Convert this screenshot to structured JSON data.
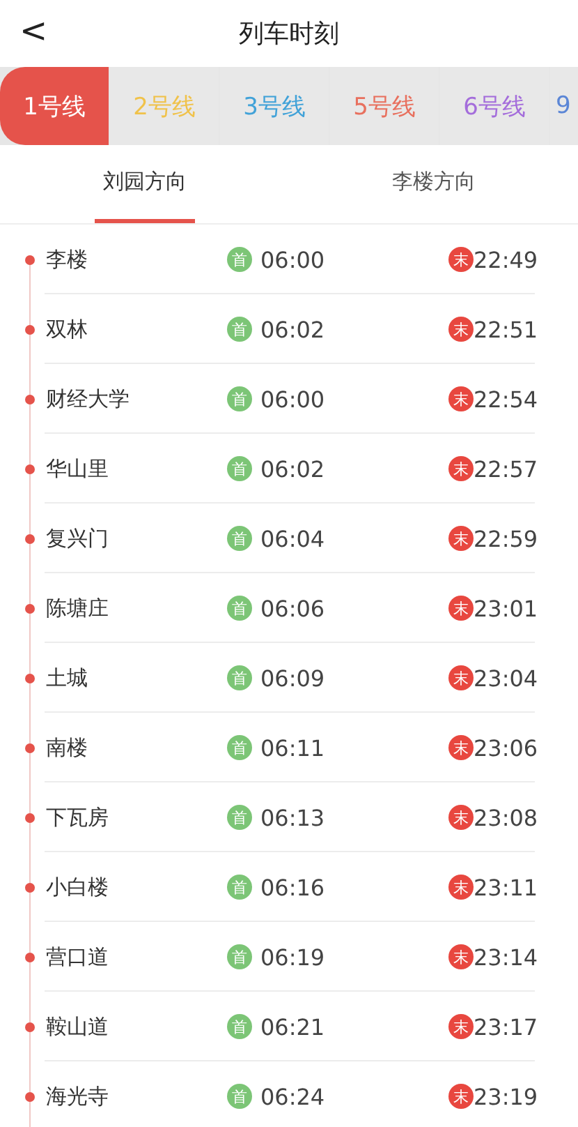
{
  "header": {
    "back": "<",
    "title": "列车时刻"
  },
  "lines": [
    {
      "label": "1号线",
      "color": "#e5534b",
      "selected": true
    },
    {
      "label": "2号线",
      "color": "#f0c24a",
      "selected": false
    },
    {
      "label": "3号线",
      "color": "#41a2d8",
      "selected": false
    },
    {
      "label": "5号线",
      "color": "#e8705e",
      "selected": false
    },
    {
      "label": "6号线",
      "color": "#a46ddb",
      "selected": false
    },
    {
      "label": "9",
      "color": "#5b86d6",
      "selected": false
    }
  ],
  "directions": [
    {
      "label": "刘园方向",
      "selected": true
    },
    {
      "label": "李楼方向",
      "selected": false
    }
  ],
  "stations": [
    {
      "name": "李楼",
      "first_badge": "首",
      "first": "06:00",
      "last_badge": "末",
      "last": "22:49"
    },
    {
      "name": "双林",
      "first_badge": "首",
      "first": "06:02",
      "last_badge": "末",
      "last": "22:51"
    },
    {
      "name": "财经大学",
      "first_badge": "首",
      "first": "06:00",
      "last_badge": "末",
      "last": "22:54"
    },
    {
      "name": "华山里",
      "first_badge": "首",
      "first": "06:02",
      "last_badge": "末",
      "last": "22:57"
    },
    {
      "name": "复兴门",
      "first_badge": "首",
      "first": "06:04",
      "last_badge": "末",
      "last": "22:59"
    },
    {
      "name": "陈塘庄",
      "first_badge": "首",
      "first": "06:06",
      "last_badge": "末",
      "last": "23:01"
    },
    {
      "name": "土城",
      "first_badge": "首",
      "first": "06:09",
      "last_badge": "末",
      "last": "23:04"
    },
    {
      "name": "南楼",
      "first_badge": "首",
      "first": "06:11",
      "last_badge": "末",
      "last": "23:06"
    },
    {
      "name": "下瓦房",
      "first_badge": "首",
      "first": "06:13",
      "last_badge": "末",
      "last": "23:08"
    },
    {
      "name": "小白楼",
      "first_badge": "首",
      "first": "06:16",
      "last_badge": "末",
      "last": "23:11"
    },
    {
      "name": "营口道",
      "first_badge": "首",
      "first": "06:19",
      "last_badge": "末",
      "last": "23:14"
    },
    {
      "name": "鞍山道",
      "first_badge": "首",
      "first": "06:21",
      "last_badge": "末",
      "last": "23:17"
    },
    {
      "name": "海光寺",
      "first_badge": "首",
      "first": "06:24",
      "last_badge": "末",
      "last": "23:19"
    }
  ]
}
